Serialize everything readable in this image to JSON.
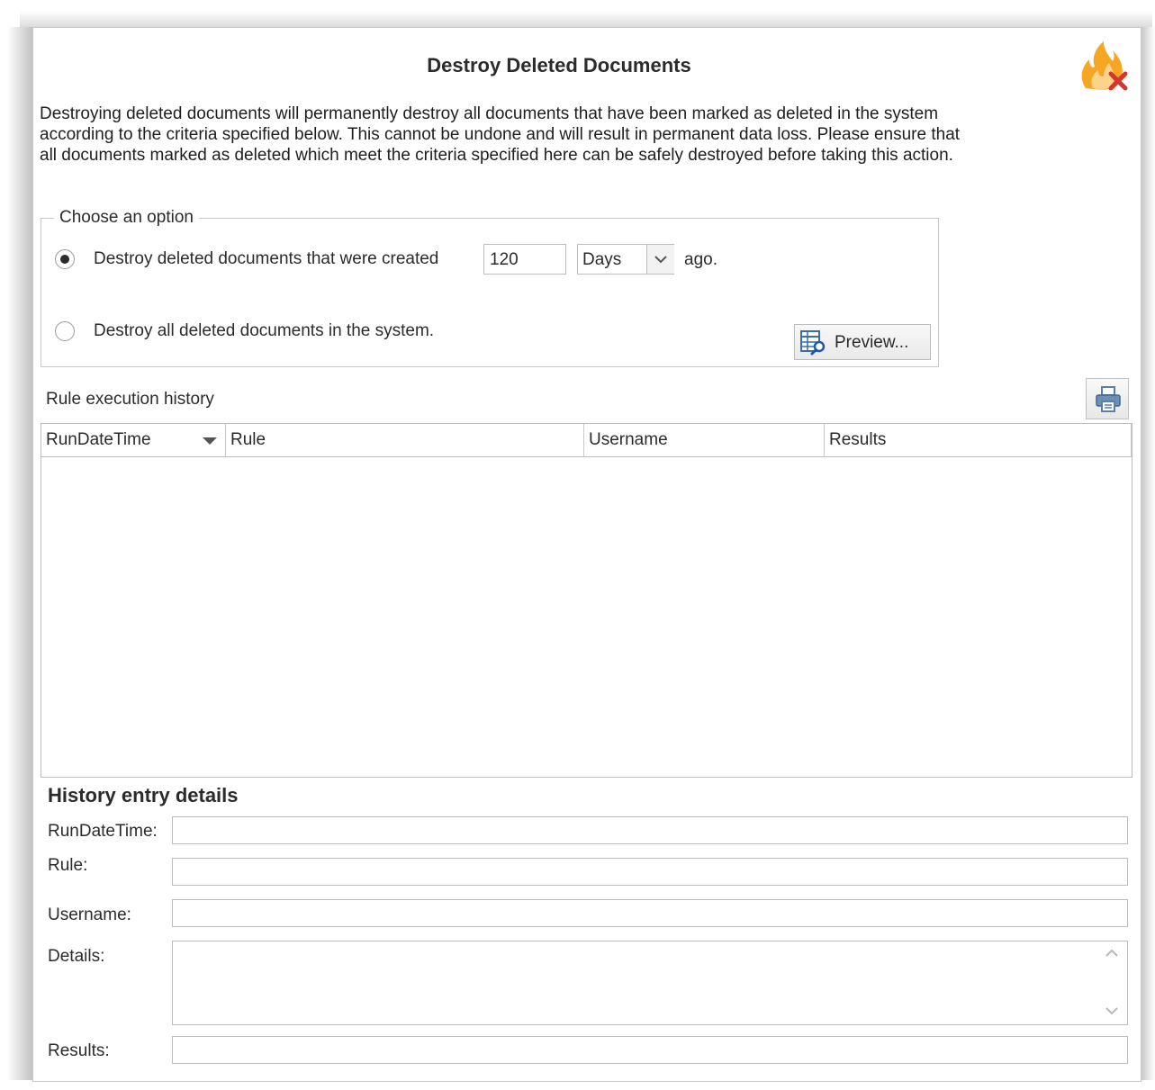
{
  "dialog": {
    "title": "Destroy Deleted Documents",
    "icon": "flame-delete-icon",
    "intro": "Destroying deleted documents will permanently destroy all documents that have been marked as deleted in the system according to the criteria specified below.  This cannot be undone and will result in permanent data loss. Please ensure that all documents marked as deleted which meet the criteria specified here can be safely destroyed before taking this action."
  },
  "options": {
    "group_label": "Choose an option",
    "option1": {
      "label": "Destroy deleted documents that were created",
      "selected": true,
      "amount": "120",
      "unit": "Days",
      "suffix": "ago."
    },
    "option2": {
      "label": "Destroy all deleted documents in the system.",
      "selected": false
    },
    "preview_label": "Preview..."
  },
  "history": {
    "label": "Rule execution history",
    "columns": [
      "RunDateTime",
      "Rule",
      "Username",
      "Results"
    ],
    "rows": []
  },
  "details": {
    "title": "History entry details",
    "labels": {
      "run_date_time": "RunDateTime:",
      "rule": "Rule:",
      "username": "Username:",
      "details": "Details:",
      "results": "Results:"
    },
    "values": {
      "run_date_time": "",
      "rule": "",
      "username": "",
      "details": "",
      "results": ""
    }
  },
  "colors": {
    "accent_flame": "#f5a623",
    "delete_x": "#d9342b"
  }
}
